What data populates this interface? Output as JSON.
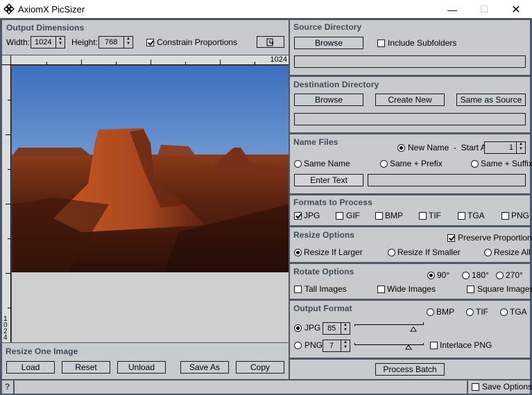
{
  "window": {
    "title": "AxiomX PicSizer",
    "controls": {
      "minimize": "—",
      "maximize": "☐",
      "close": "✕"
    }
  },
  "output_dimensions": {
    "title": "Output Dimensions",
    "width_label": "Width:",
    "width_value": "1024",
    "height_label": "Height:",
    "height_value": "768",
    "constrain_label": "Constrain Proportions",
    "constrain_checked": true,
    "fit_icon": "fit-to-window-icon"
  },
  "ruler": {
    "h_start": "0",
    "h_end": "1024",
    "v_start": "0",
    "v_end": "1024"
  },
  "preview": {
    "image_description": "Desert mesa landscape at sunset"
  },
  "resize_one": {
    "title": "Resize One Image",
    "buttons": [
      "Load",
      "Reset",
      "Unload",
      "Save As",
      "Copy"
    ]
  },
  "source_directory": {
    "title": "Source Directory",
    "browse_label": "Browse",
    "include_subfolders_label": "Include Subfolders",
    "include_subfolders_checked": false,
    "path": ""
  },
  "destination_directory": {
    "title": "Destination Directory",
    "browse_label": "Browse",
    "create_new_label": "Create New",
    "same_as_source_label": "Same as Source",
    "path": ""
  },
  "name_files": {
    "title": "Name Files",
    "new_name_label": "New Name  -  Start At:",
    "start_at_value": "1",
    "same_name_label": "Same Name",
    "same_prefix_label": "Same + Prefix",
    "same_suffix_label": "Same + Suffix",
    "selected": "New Name",
    "enter_text_label": "Enter Text",
    "text_value": ""
  },
  "formats": {
    "title": "Formats to Process",
    "items": [
      {
        "label": "JPG",
        "checked": true
      },
      {
        "label": "GIF",
        "checked": false
      },
      {
        "label": "BMP",
        "checked": false
      },
      {
        "label": "TIF",
        "checked": false
      },
      {
        "label": "TGA",
        "checked": false
      },
      {
        "label": "PNG",
        "checked": false
      }
    ]
  },
  "resize_options": {
    "title": "Resize Options",
    "preserve_label": "Preserve Proportions",
    "preserve_checked": true,
    "options": [
      "Resize If Larger",
      "Resize If Smaller",
      "Resize All"
    ],
    "selected": "Resize If Larger"
  },
  "rotate_options": {
    "title": "Rotate Options",
    "angles": [
      "90°",
      "180°",
      "270°"
    ],
    "selected": "90°",
    "tall_label": "Tall Images",
    "wide_label": "Wide Images",
    "square_label": "Square Images"
  },
  "output_format": {
    "title": "Output Format",
    "bmp_label": "BMP",
    "tif_label": "TIF",
    "tga_label": "TGA",
    "jpg_label": "JPG",
    "jpg_quality": "85",
    "jpg_slider_fraction": 0.85,
    "png_label": "PNG",
    "png_compression": "7",
    "png_slider_fraction": 0.78,
    "interlace_label": "Interlace PNG",
    "selected": "JPG"
  },
  "process_batch_label": "Process Batch",
  "status": {
    "help": "?",
    "text": "",
    "save_options_label": "Save Options"
  }
}
